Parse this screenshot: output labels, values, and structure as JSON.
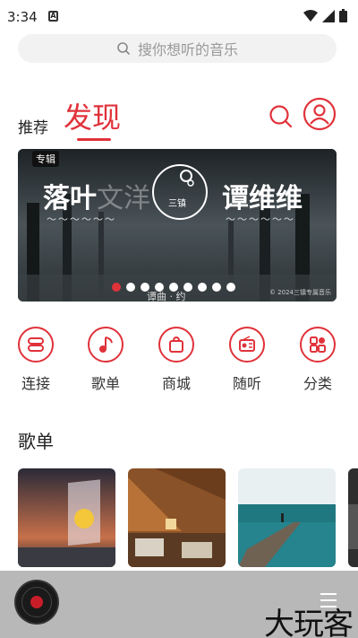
{
  "status": {
    "time": "3:34",
    "notif_icon": "A"
  },
  "search": {
    "placeholder": "搜你想听的音乐"
  },
  "tabs": {
    "recommend": "推荐",
    "discover": "发现"
  },
  "banner": {
    "badge": "专辑",
    "title_left": "落叶",
    "title_left_faded": "文洋",
    "title_right": "谭维维",
    "logo_text": "三镇",
    "caption": "谭曲 · 约",
    "copyright": "© 2024三镇专属音乐",
    "slides": 9,
    "active_slide": 1
  },
  "quick_nav": [
    {
      "label": "连接",
      "icon": "link-icon"
    },
    {
      "label": "歌单",
      "icon": "music-note-icon"
    },
    {
      "label": "商城",
      "icon": "shopping-bag-icon"
    },
    {
      "label": "随听",
      "icon": "radio-icon"
    },
    {
      "label": "分类",
      "icon": "category-icon"
    }
  ],
  "section": {
    "title": "歌单"
  },
  "playlists": [
    {
      "name": "sunset-art",
      "colors": [
        "#2b2a38",
        "#e77a3a"
      ]
    },
    {
      "name": "wooden-attic",
      "colors": [
        "#6b3d1c",
        "#d99b5c"
      ]
    },
    {
      "name": "sea-pier",
      "colors": [
        "#1f6f78",
        "#cfe4e8"
      ]
    },
    {
      "name": "partial",
      "colors": [
        "#333333",
        "#666666"
      ]
    }
  ],
  "watermark": "大玩客",
  "accent": "#e0323a"
}
